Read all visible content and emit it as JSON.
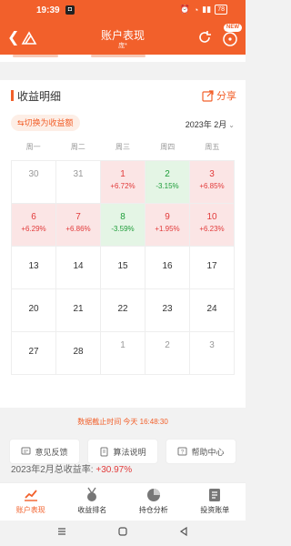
{
  "status": {
    "time": "19:39",
    "battery": "78"
  },
  "header": {
    "title": "账户表现",
    "subtitle": "庞*",
    "new_badge": "NEW"
  },
  "section": {
    "title": "收益明细",
    "share_label": "分享",
    "toggle_label": "⇆切换为收益额",
    "month": "2023年 2月"
  },
  "weekdays": [
    "周一",
    "周二",
    "周三",
    "周四",
    "周五"
  ],
  "calendar": [
    [
      {
        "day": "30",
        "pct": "",
        "kind": "other"
      },
      {
        "day": "31",
        "pct": "",
        "kind": "other"
      },
      {
        "day": "1",
        "pct": "+6.72%",
        "kind": "up"
      },
      {
        "day": "2",
        "pct": "-3.15%",
        "kind": "down"
      },
      {
        "day": "3",
        "pct": "+6.85%",
        "kind": "up"
      }
    ],
    [
      {
        "day": "6",
        "pct": "+6.29%",
        "kind": "up"
      },
      {
        "day": "7",
        "pct": "+6.86%",
        "kind": "up"
      },
      {
        "day": "8",
        "pct": "-3.59%",
        "kind": "down"
      },
      {
        "day": "9",
        "pct": "+1.95%",
        "kind": "up"
      },
      {
        "day": "10",
        "pct": "+6.23%",
        "kind": "up"
      }
    ],
    [
      {
        "day": "13",
        "pct": "",
        "kind": "plain"
      },
      {
        "day": "14",
        "pct": "",
        "kind": "plain"
      },
      {
        "day": "15",
        "pct": "",
        "kind": "plain"
      },
      {
        "day": "16",
        "pct": "",
        "kind": "plain"
      },
      {
        "day": "17",
        "pct": "",
        "kind": "plain"
      }
    ],
    [
      {
        "day": "20",
        "pct": "",
        "kind": "plain"
      },
      {
        "day": "21",
        "pct": "",
        "kind": "plain"
      },
      {
        "day": "22",
        "pct": "",
        "kind": "plain"
      },
      {
        "day": "23",
        "pct": "",
        "kind": "plain"
      },
      {
        "day": "24",
        "pct": "",
        "kind": "plain"
      }
    ],
    [
      {
        "day": "27",
        "pct": "",
        "kind": "plain"
      },
      {
        "day": "28",
        "pct": "",
        "kind": "plain"
      },
      {
        "day": "1",
        "pct": "",
        "kind": "other"
      },
      {
        "day": "2",
        "pct": "",
        "kind": "other"
      },
      {
        "day": "3",
        "pct": "",
        "kind": "other"
      }
    ]
  ],
  "total": {
    "label": "2023年2月总收益率: ",
    "value": "+30.97%"
  },
  "deadline": "数据截止时间 今天 16:48:30",
  "quick": {
    "feedback": "意见反馈",
    "algorithm": "算法说明",
    "help": "帮助中心"
  },
  "tabs": [
    {
      "label": "账户表现",
      "icon": "chart-line-icon"
    },
    {
      "label": "收益排名",
      "icon": "medal-icon"
    },
    {
      "label": "持仓分析",
      "icon": "pie-chart-icon"
    },
    {
      "label": "投资账单",
      "icon": "bill-icon"
    }
  ],
  "colors": {
    "accent": "#f2602b",
    "up": "#e23b3b",
    "down": "#1f9d3a"
  }
}
